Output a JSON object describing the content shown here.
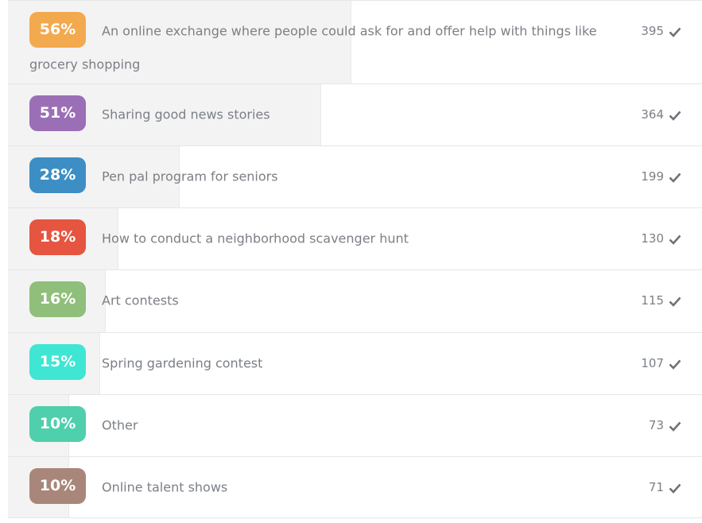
{
  "poll": {
    "rows": [
      {
        "percent_label": "56%",
        "percent": 56,
        "label": "An online exchange where people could ask for and offer help with things like grocery shopping",
        "count": "395",
        "color": "#f3a94e",
        "height": 106
      },
      {
        "percent_label": "51%",
        "percent": 51,
        "label": "Sharing good news stories",
        "count": "364",
        "color": "#9b6fb5",
        "height": 78
      },
      {
        "percent_label": "28%",
        "percent": 28,
        "label": "Pen pal program for seniors",
        "count": "199",
        "color": "#3d8ec4",
        "height": 78
      },
      {
        "percent_label": "18%",
        "percent": 18,
        "label": "How to conduct a neighborhood scavenger hunt",
        "count": "130",
        "color": "#e5553f",
        "height": 78
      },
      {
        "percent_label": "16%",
        "percent": 16,
        "label": "Art contests",
        "count": "115",
        "color": "#8fbf7a",
        "height": 79
      },
      {
        "percent_label": "15%",
        "percent": 15,
        "label": "Spring gardening contest",
        "count": "107",
        "color": "#3fe6d4",
        "height": 78
      },
      {
        "percent_label": "10%",
        "percent": 10,
        "label": "Other",
        "count": "73",
        "color": "#4fcfac",
        "height": 78
      },
      {
        "percent_label": "10%",
        "percent": 10,
        "label": "Online talent shows",
        "count": "71",
        "color": "#a8877a",
        "height": 77
      }
    ],
    "check_icon": "check-icon"
  }
}
